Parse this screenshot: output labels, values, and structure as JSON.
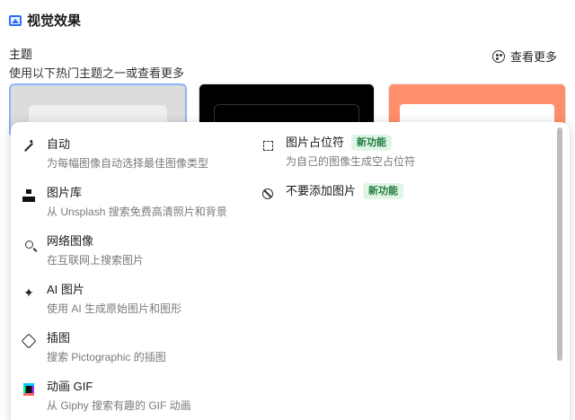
{
  "header": {
    "title": "视觉效果",
    "icon": "image-icon"
  },
  "theme": {
    "label": "主题",
    "subtitle": "使用以下热门主题之一或查看更多",
    "see_more": "查看更多",
    "see_more_icon": "palette-icon"
  },
  "menu": {
    "left_items": [
      {
        "icon": "magic-wand-icon",
        "name": "自动",
        "desc": "为每幅图像自动选择最佳图像类型"
      },
      {
        "icon": "unsplash-icon",
        "name": "图片库",
        "desc": "从 Unsplash 搜索免费高清照片和背景"
      },
      {
        "icon": "search-icon",
        "name": "网络图像",
        "desc": "在互联网上搜索图片"
      },
      {
        "icon": "sparkle-icon",
        "name": "AI 图片",
        "desc": "使用 AI 生成原始图片和图形"
      },
      {
        "icon": "cube-icon",
        "name": "插图",
        "desc": "搜索 Pictographic 的插图"
      },
      {
        "icon": "giphy-icon",
        "name": "动画 GIF",
        "desc": "从 Giphy 搜索有趣的 GIF 动画"
      }
    ],
    "right_items": [
      {
        "icon": "placeholder-icon",
        "name": "图片占位符",
        "badge": "新功能",
        "desc": "为自己的图像生成空占位符"
      },
      {
        "icon": "ban-icon",
        "name": "不要添加图片",
        "badge": "新功能",
        "desc": ""
      }
    ]
  },
  "colors": {
    "accent": "#2f6df6",
    "badge_bg": "#e1f5e6",
    "badge_text": "#1e7a3c",
    "theme3": "#ff8e6b"
  }
}
